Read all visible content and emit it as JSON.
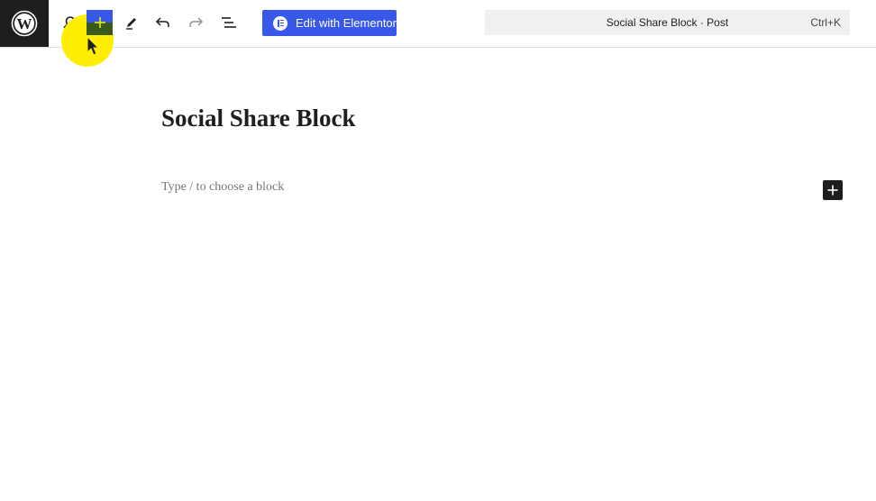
{
  "toolbar": {
    "logo_icon": "wordpress-logo-icon",
    "search_icon": "search-icon",
    "add_icon": "plus-icon",
    "tools_icon": "pencil-icon",
    "undo_icon": "undo-icon",
    "redo_icon": "redo-icon",
    "list_view_icon": "list-view-icon",
    "elementor_label": "Edit with Elementor",
    "command_title": "Social Share Block · Post",
    "command_shortcut": "Ctrl+K"
  },
  "editor": {
    "post_title": "Social Share Block",
    "block_placeholder": "Type / to choose a block",
    "inline_add_icon": "plus-icon"
  },
  "colors": {
    "accent": "#3858e9",
    "dark": "#1e1e1e",
    "highlight": "#ffee00"
  }
}
